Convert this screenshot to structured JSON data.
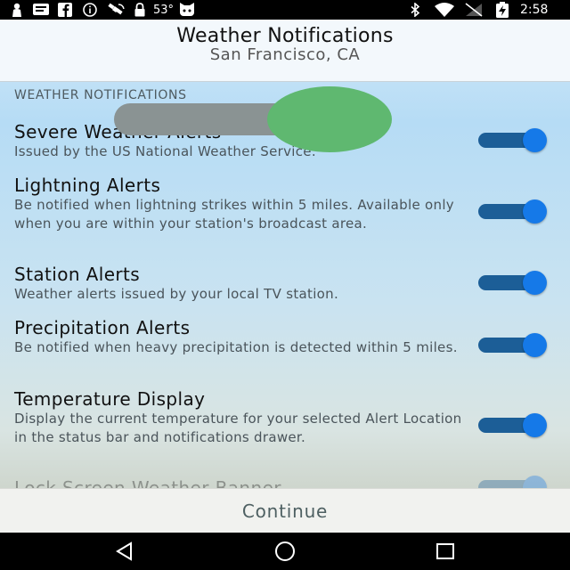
{
  "status_bar": {
    "temperature": "53°",
    "time": "2:58",
    "icons": [
      "person-icon",
      "message-icon",
      "facebook-icon",
      "info-icon",
      "satellite-icon",
      "lock-icon",
      "weather-icon",
      "bluetooth-icon",
      "wifi-icon",
      "no-signal-icon",
      "battery-charging-icon"
    ]
  },
  "header": {
    "title": "Weather Notifications",
    "subtitle": "San Francisco, CA"
  },
  "section_label": "WEATHER NOTIFICATIONS",
  "settings": [
    {
      "title": "Severe Weather Alerts",
      "description": "Issued by the US National Weather Service.",
      "enabled": true
    },
    {
      "title": "Lightning Alerts",
      "description": "Be notified when lightning strikes within 5 miles. Available only when you are within your station's broadcast area.",
      "enabled": true
    },
    {
      "title": "Station Alerts",
      "description": "Weather alerts issued by your local TV station.",
      "enabled": true
    },
    {
      "title": "Precipitation Alerts",
      "description": "Be notified when heavy precipitation is detected within 5 miles.",
      "enabled": true
    },
    {
      "title": "Temperature Display",
      "description": "Display the current temperature for your selected Alert Location in the status bar and notifications drawer.",
      "enabled": true
    },
    {
      "title": "Lock Screen Weather Banner",
      "description": "",
      "enabled": true
    }
  ],
  "continue_label": "Continue",
  "nav": {
    "icons": [
      "back-icon",
      "home-icon",
      "recents-icon"
    ]
  },
  "colors": {
    "toggle_track": "#1c5e97",
    "toggle_thumb": "#1579e8",
    "overlay_green": "#5fb870",
    "overlay_gray": "#8a9393"
  }
}
